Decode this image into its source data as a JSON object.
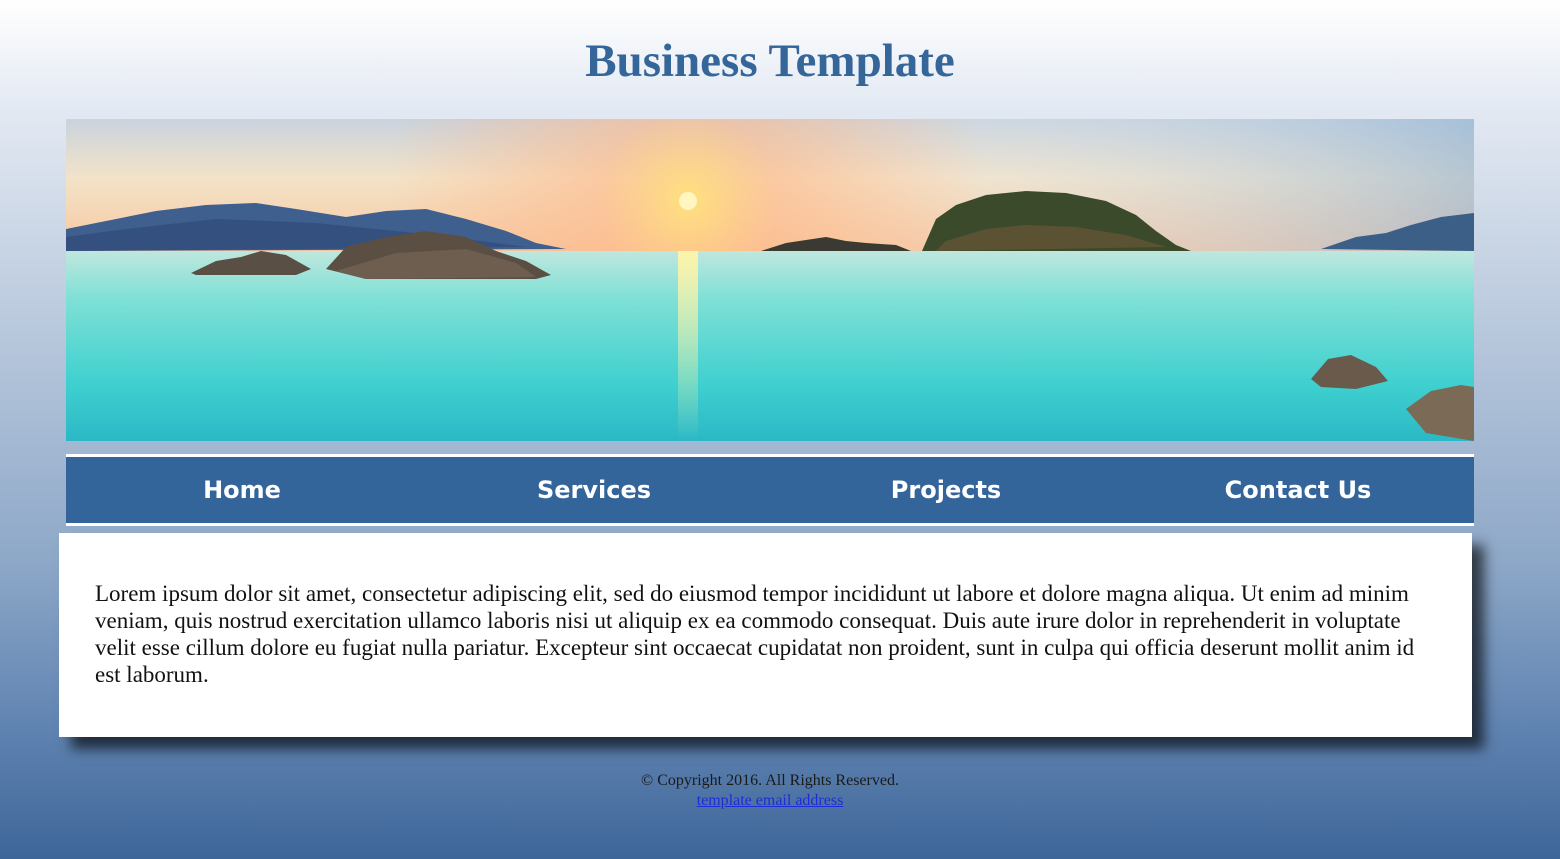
{
  "header": {
    "title": "Business Template"
  },
  "banner": {
    "icon": "seascape-sunset-image"
  },
  "nav": {
    "items": [
      {
        "label": "Home"
      },
      {
        "label": "Services"
      },
      {
        "label": "Projects"
      },
      {
        "label": "Contact Us"
      }
    ]
  },
  "main": {
    "body_text": "Lorem ipsum dolor sit amet, consectetur adipiscing elit, sed do eiusmod tempor incididunt ut labore et dolore magna aliqua. Ut enim ad minim veniam, quis nostrud exercitation ullamco laboris nisi ut aliquip ex ea commodo consequat. Duis aute irure dolor in reprehenderit in voluptate velit esse cillum dolore eu fugiat nulla pariatur. Excepteur sint occaecat cupidatat non proident, sunt in culpa qui officia deserunt mollit anim id est laborum."
  },
  "footer": {
    "copyright": "© Copyright 2016. All Rights Reserved.",
    "email_link": "template email address"
  },
  "colors": {
    "brand_blue": "#35669a",
    "nav_background": "#34659a",
    "link_blue": "#1f2bd8"
  }
}
